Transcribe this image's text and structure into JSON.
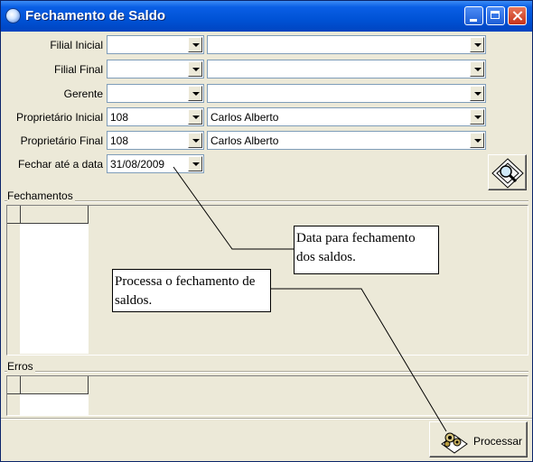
{
  "window": {
    "title": "Fechamento de Saldo"
  },
  "fields": [
    {
      "label": "Filial Inicial",
      "code": "",
      "name": ""
    },
    {
      "label": "Filial Final",
      "code": "",
      "name": ""
    },
    {
      "label": "Gerente",
      "code": "",
      "name": ""
    },
    {
      "label": "Proprietário Inicial",
      "code": "108",
      "name": "Carlos Alberto"
    },
    {
      "label": "Proprietário Final",
      "code": "108",
      "name": "Carlos Alberto"
    }
  ],
  "date": {
    "label": "Fechar até a data",
    "value": "31/08/2009"
  },
  "groups": {
    "fechamentos": "Fechamentos",
    "erros": "Erros"
  },
  "buttons": {
    "processar": "Processar",
    "search_icon": "magnifier-icon",
    "processar_icon": "gears-icon"
  },
  "callouts": {
    "data": "Data para fechamento dos saldos.",
    "processa": "Processa o fechamento de saldos."
  },
  "colors": {
    "titlebar": "#0052d6",
    "window_bg": "#ece9d8"
  }
}
